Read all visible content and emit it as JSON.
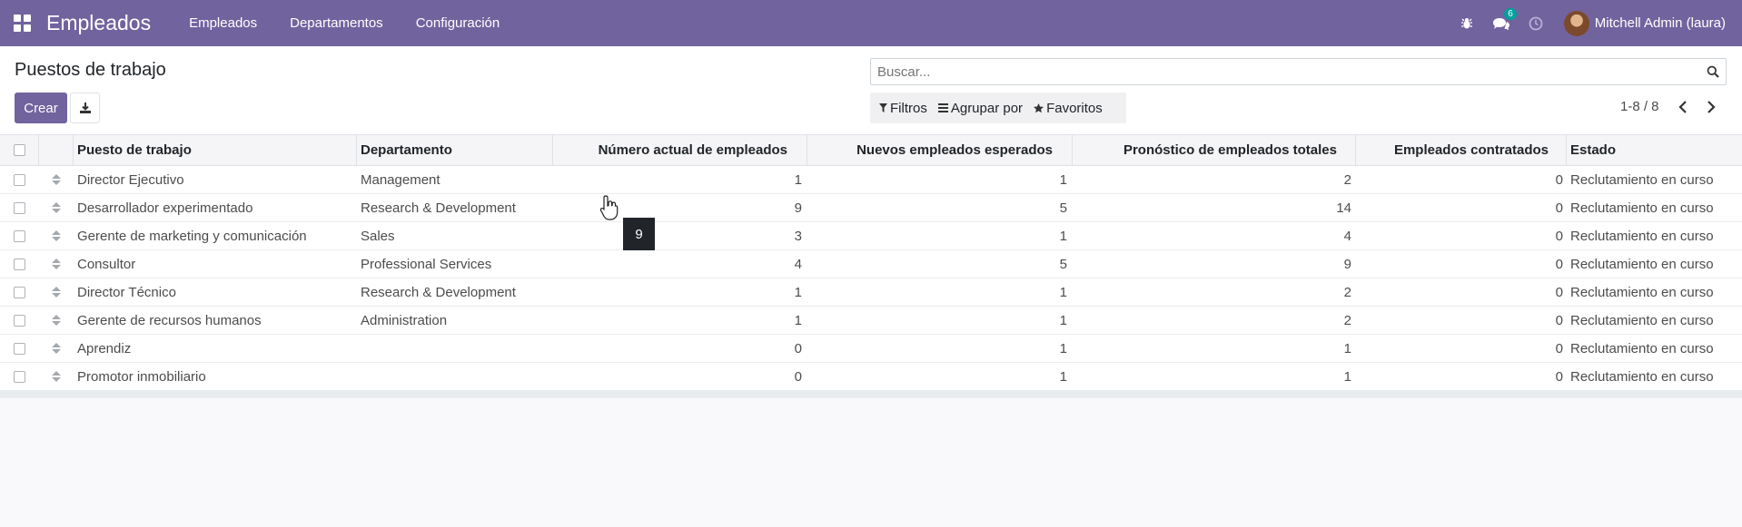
{
  "navbar": {
    "app_name": "Empleados",
    "menus": [
      "Empleados",
      "Departamentos",
      "Configuración"
    ],
    "messages_count": "6",
    "user_name": "Mitchell Admin (laura)",
    "bg_color": "#71639e"
  },
  "control_panel": {
    "title": "Puestos de trabajo",
    "create_label": "Crear",
    "search_placeholder": "Buscar...",
    "filters_label": "Filtros",
    "groupby_label": "Agrupar por",
    "favorites_label": "Favoritos",
    "pager": "1-8 / 8"
  },
  "table": {
    "headers": [
      "Puesto de trabajo",
      "Departamento",
      "Número actual de empleados",
      "Nuevos empleados esperados",
      "Pronóstico de empleados totales",
      "Empleados contratados",
      "Estado"
    ],
    "rows": [
      {
        "name": "Director Ejecutivo",
        "department": "Management",
        "current": "1",
        "expected": "1",
        "forecast": "2",
        "hired": "0",
        "state": "Reclutamiento en curso"
      },
      {
        "name": "Desarrollador experimentado",
        "department": "Research & Development",
        "current": "9",
        "expected": "5",
        "forecast": "14",
        "hired": "0",
        "state": "Reclutamiento en curso"
      },
      {
        "name": "Gerente de marketing y comunicación",
        "department": "Sales",
        "current": "3",
        "expected": "1",
        "forecast": "4",
        "hired": "0",
        "state": "Reclutamiento en curso"
      },
      {
        "name": "Consultor",
        "department": "Professional Services",
        "current": "4",
        "expected": "5",
        "forecast": "9",
        "hired": "0",
        "state": "Reclutamiento en curso"
      },
      {
        "name": "Director Técnico",
        "department": "Research & Development",
        "current": "1",
        "expected": "1",
        "forecast": "2",
        "hired": "0",
        "state": "Reclutamiento en curso"
      },
      {
        "name": "Gerente de recursos humanos",
        "department": "Administration",
        "current": "1",
        "expected": "1",
        "forecast": "2",
        "hired": "0",
        "state": "Reclutamiento en curso"
      },
      {
        "name": "Aprendiz",
        "department": "",
        "current": "0",
        "expected": "1",
        "forecast": "1",
        "hired": "0",
        "state": "Reclutamiento en curso"
      },
      {
        "name": "Promotor inmobiliario",
        "department": "",
        "current": "0",
        "expected": "1",
        "forecast": "1",
        "hired": "0",
        "state": "Reclutamiento en curso"
      }
    ]
  },
  "tooltip": {
    "text": "9"
  }
}
